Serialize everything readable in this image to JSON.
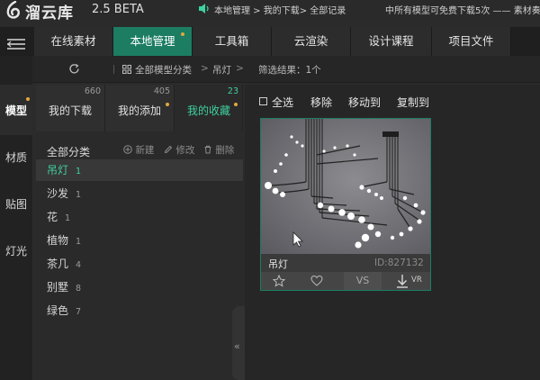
{
  "titlebar": {
    "app_name": "溜云库",
    "version": "2.5 BETA",
    "breadcrumb": "本地管理 > 我的下载> 全部记录",
    "marquee": "中所有模型可免费下载5次 —— 素材奏颜"
  },
  "nav": {
    "tabs": [
      {
        "label": "在线素材"
      },
      {
        "label": "本地管理"
      },
      {
        "label": "工具箱"
      },
      {
        "label": "云渲染"
      },
      {
        "label": "设计课程"
      },
      {
        "label": "项目文件"
      }
    ],
    "active_index": 1
  },
  "subbar": {
    "all_categories": "全部模型分类",
    "separator": ">",
    "current": "吊灯",
    "filter_result": "筛选结果：1个"
  },
  "left_tabs": [
    {
      "label": "模型"
    },
    {
      "label": "材质"
    },
    {
      "label": "贴图"
    },
    {
      "label": "灯光"
    }
  ],
  "sub_tabs": [
    {
      "label": "我的下载",
      "count": "660"
    },
    {
      "label": "我的添加",
      "count": "405"
    },
    {
      "label": "我的收藏",
      "count": "23"
    }
  ],
  "categories": {
    "header": "全部分类",
    "new_label": "新建",
    "edit_label": "修改",
    "delete_label": "删除",
    "items": [
      {
        "name": "吊灯",
        "count": "1"
      },
      {
        "name": "沙发",
        "count": "1"
      },
      {
        "name": "花",
        "count": "1"
      },
      {
        "name": "植物",
        "count": "1"
      },
      {
        "name": "茶几",
        "count": "4"
      },
      {
        "name": "别墅",
        "count": "8"
      },
      {
        "name": "绿色",
        "count": "7"
      }
    ],
    "collapse_glyph": "«"
  },
  "toolbar": {
    "select_all": "全选",
    "remove": "移除",
    "move_to": "移动到",
    "copy_to": "复制到"
  },
  "card": {
    "title": "吊灯",
    "id": "ID:827132",
    "vs_label": "VS",
    "vr_label": "VR"
  },
  "colors": {
    "accent": "#1c7d62",
    "accent_text": "#3fd0a0",
    "badge_dot": "#e0a840"
  }
}
